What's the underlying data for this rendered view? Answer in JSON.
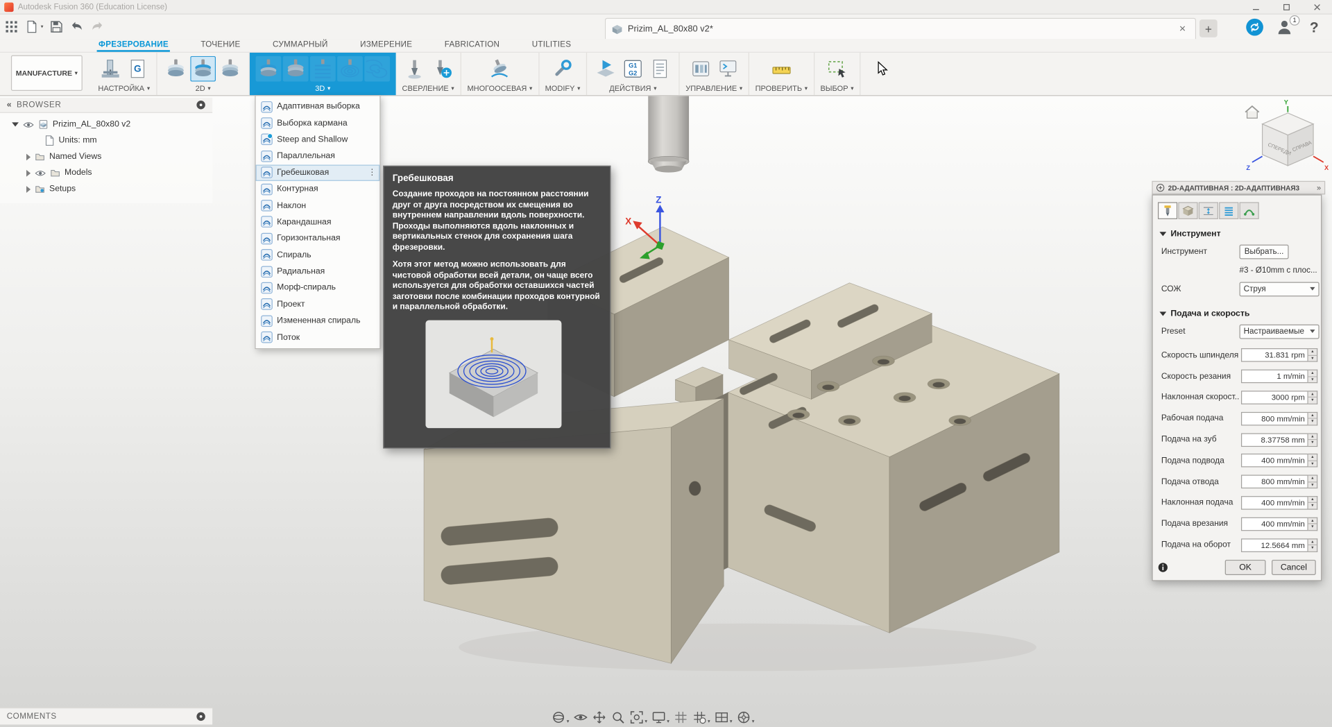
{
  "colors": {
    "accent": "#0696d7",
    "ribbon_highlight": "#1899d6",
    "tooltip_bg": "#424242",
    "model_tan": "#d6d0be"
  },
  "titlebar": {
    "title": "Autodesk Fusion 360 (Education License)"
  },
  "appbar": {
    "doc_tab_title": "Prizim_AL_80x80 v2*",
    "user_badge_count": "1"
  },
  "ribbon_tabs": [
    {
      "label": "ФРЕЗЕРОВАНИЕ",
      "active": true
    },
    {
      "label": "ТОЧЕНИЕ"
    },
    {
      "label": "СУММАРНЫЙ"
    },
    {
      "label": "ИЗМЕРЕНИЕ"
    },
    {
      "label": "FABRICATION"
    },
    {
      "label": "UTILITIES"
    }
  ],
  "ribbon": {
    "workspace_button": "MANUFACTURE",
    "groups": [
      {
        "label": "НАСТРОЙКА",
        "icons": [
          "setup-machine-icon",
          "gcode-doc-icon"
        ]
      },
      {
        "label": "2D",
        "icons": [
          "face-mill-icon",
          "adaptive2d-icon",
          "pocket2d-icon"
        ],
        "selected_icon": 1
      },
      {
        "label": "3D",
        "icons": [
          "adaptive3d-icon",
          "pocket3d-icon",
          "parallel-icon",
          "scallop-icon",
          "spiral-icon"
        ],
        "highlighted": true
      },
      {
        "label": "СВЕРЛЕНИЕ",
        "icons": [
          "drill-icon",
          "thread-icon"
        ]
      },
      {
        "label": "МНОГООСЕВАЯ",
        "icons": [
          "multiaxis-icon"
        ]
      },
      {
        "label": "MODIFY",
        "icons": [
          "modify-icon"
        ]
      },
      {
        "label": "ДЕЙСТВИЯ",
        "icons": [
          "simulate-icon",
          "post-process-icon",
          "setup-sheet-icon"
        ]
      },
      {
        "label": "УПРАВЛЕНИЕ",
        "icons": [
          "tool-library-icon",
          "task-manager-icon"
        ]
      },
      {
        "label": "ПРОВЕРИТЬ",
        "icons": [
          "inspect-icon"
        ]
      },
      {
        "label": "ВЫБОР",
        "icons": [
          "selection-box-icon"
        ]
      }
    ]
  },
  "menu3d": {
    "items": [
      {
        "label": "Адаптивная выборка",
        "icon": "strategy-icon"
      },
      {
        "label": "Выборка кармана",
        "icon": "strategy-icon"
      },
      {
        "label": "Steep and Shallow",
        "icon": "strategy-new-icon"
      },
      {
        "label": "Параллельная",
        "icon": "strategy-icon"
      },
      {
        "label": "Гребешковая",
        "icon": "strategy-icon",
        "selected": true
      },
      {
        "label": "Контурная",
        "icon": "strategy-icon"
      },
      {
        "label": "Наклон",
        "icon": "strategy-icon"
      },
      {
        "label": "Карандашная",
        "icon": "strategy-icon"
      },
      {
        "label": "Горизонтальная",
        "icon": "strategy-icon"
      },
      {
        "label": "Спираль",
        "icon": "strategy-icon"
      },
      {
        "label": "Радиальная",
        "icon": "strategy-icon"
      },
      {
        "label": "Морф-спираль",
        "icon": "strategy-icon"
      },
      {
        "label": "Проект",
        "icon": "strategy-icon"
      },
      {
        "label": "Измененная спираль",
        "icon": "strategy-icon"
      },
      {
        "label": "Поток",
        "icon": "strategy-icon"
      }
    ]
  },
  "tooltip": {
    "title": "Гребешковая",
    "para1": "Создание проходов на постоянном расстоянии друг от друга посредством их смещения во внутреннем направлении вдоль поверхности. Проходы выполняются вдоль наклонных и вертикальных стенок для сохранения шага фрезеровки.",
    "para2": "Хотя этот метод можно использовать для чистовой обработки всей детали, он чаще всего используется для обработки оставшихся частей заготовки после комбинации проходов контурной и параллельной обработки."
  },
  "browser": {
    "header": "BROWSER",
    "rows": [
      {
        "label": "Prizim_AL_80x80 v2",
        "twisty": "open",
        "eye": true,
        "icon": "component-icon",
        "level": 0
      },
      {
        "label": "Units: mm",
        "icon": "units-icon",
        "level": 1
      },
      {
        "label": "Named Views",
        "twisty": "closed",
        "icon": "folder-icon",
        "level": 2
      },
      {
        "label": "Models",
        "twisty": "closed",
        "eye": true,
        "icon": "folder-icon",
        "level": 2
      },
      {
        "label": "Setups",
        "twisty": "closed",
        "icon": "setups-icon",
        "level": 2
      }
    ]
  },
  "comments": {
    "label": "COMMENTS"
  },
  "navbar": {
    "items": [
      {
        "icon": "orbit-icon",
        "dropdown": true
      },
      {
        "icon": "look-at-icon"
      },
      {
        "icon": "pan-icon"
      },
      {
        "icon": "zoom-icon"
      },
      {
        "icon": "fit-icon",
        "dropdown": true
      },
      {
        "icon": "display-settings-icon",
        "dropdown": true
      },
      {
        "icon": "grid-icon"
      },
      {
        "icon": "grid-settings-icon",
        "dropdown": true
      },
      {
        "icon": "viewports-icon",
        "dropdown": true
      },
      {
        "icon": "navigation-icon",
        "dropdown": true
      }
    ]
  },
  "dialog": {
    "header": "2D-АДАПТИВНАЯ : 2D-АДАПТИВНАЯ3",
    "tabs": [
      {
        "icon": "tab-tool-icon",
        "selected": true
      },
      {
        "icon": "tab-geometry-icon"
      },
      {
        "icon": "tab-heights-icon"
      },
      {
        "icon": "tab-passes-icon"
      },
      {
        "icon": "tab-linking-icon"
      }
    ],
    "sections": {
      "tool": {
        "title": "Инструмент",
        "tool_label": "Инструмент",
        "select_button": "Выбрать...",
        "tool_desc": "#3 - Ø10mm с плос...",
        "coolant_label": "СОЖ",
        "coolant_value": "Струя"
      },
      "feeds": {
        "title": "Подача и скорость",
        "preset_label": "Preset",
        "preset_value": "Настраиваемые",
        "rows": [
          {
            "label": "Скорость шпинделя",
            "value": "31.831 rpm"
          },
          {
            "label": "Скорость резания",
            "value": "1 m/min"
          },
          {
            "label": "Наклонная скорост...",
            "value": "3000 rpm"
          },
          {
            "label": "Рабочая подача",
            "value": "800 mm/min"
          },
          {
            "label": "Подача на зуб",
            "value": "8.37758 mm"
          },
          {
            "label": "Подача подвода",
            "value": "400 mm/min"
          },
          {
            "label": "Подача отвода",
            "value": "800 mm/min"
          },
          {
            "label": "Наклонная подача",
            "value": "400 mm/min"
          },
          {
            "label": "Подача врезания",
            "value": "400 mm/min"
          },
          {
            "label": "Подача на оборот",
            "value": "12.5664 mm"
          }
        ]
      }
    },
    "ok": "OK",
    "cancel": "Cancel"
  },
  "viewcube": {
    "front_label": "СПЕРЕДИ",
    "right_label": "СПРАВА",
    "x": "X",
    "y": "Y",
    "z": "Z"
  },
  "viewport_axes": {
    "x": "X",
    "z": "Z"
  }
}
